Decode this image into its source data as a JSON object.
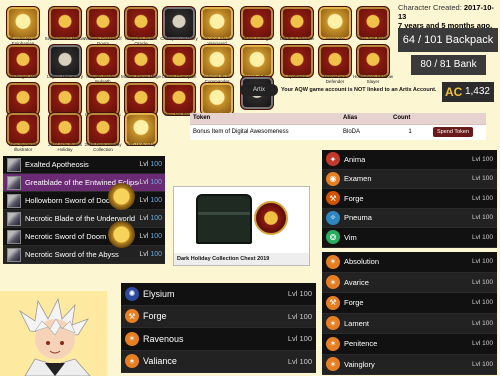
{
  "badges": [
    {
      "label": "Bloodsnapper Epiphanian",
      "style": "gold"
    },
    {
      "label": "Sepulchure's Hollow",
      "style": ""
    },
    {
      "label": "Nuclear Crazed Of Doom",
      "style": ""
    },
    {
      "label": "Nulgath's Grand Oracle",
      "style": ""
    },
    {
      "label": "Champion of Glory",
      "style": "dark"
    },
    {
      "label": "Draconic Flame Vanguard",
      "style": "gold"
    },
    {
      "label": "Chaos Avenger",
      "style": ""
    },
    {
      "label": "Blade of Shadow",
      "style": ""
    },
    {
      "label": "Awesome",
      "style": "gold"
    },
    {
      "label": "You Just Read",
      "style": ""
    },
    {
      "label": "Harbinger Hall",
      "style": ""
    },
    {
      "label": "Legion Mercenary",
      "style": "dark"
    },
    {
      "label": "Nulgath Blade of Nulgath",
      "style": ""
    },
    {
      "label": "Master Flame Mage",
      "style": ""
    },
    {
      "label": "Chaos Champion",
      "style": ""
    },
    {
      "label": "Celestial Pirate Commander",
      "style": "gold"
    },
    {
      "label": "Dragon of Time",
      "style": "gold"
    },
    {
      "label": "Apothesis",
      "style": ""
    },
    {
      "label": "Hollowborn Defender",
      "style": ""
    },
    {
      "label": "Hollowborn Shadow Slayer",
      "style": ""
    },
    {
      "label": "Hollowborn Archfiend",
      "style": ""
    },
    {
      "label": "Hollowborn Harbinger",
      "style": ""
    },
    {
      "label": "Master of Moglins",
      "style": ""
    },
    {
      "label": "Player Advisor",
      "style": ""
    },
    {
      "label": "New Nel Brent",
      "style": ""
    },
    {
      "label": "Martial Mind",
      "style": "gold"
    },
    {
      "label": "",
      "style": "dark"
    },
    {
      "label": "Artix Systems' Illustrator",
      "style": ""
    },
    {
      "label": "2024 Artix Points Holiday",
      "style": ""
    },
    {
      "label": "2019 Dark Holiday Collection",
      "style": ""
    },
    {
      "label": "10th Unholiday",
      "style": "gold"
    }
  ],
  "account": {
    "created_label": "Character Created:",
    "created_date": "2017-10-13",
    "age": "7 years and 5 months ago."
  },
  "backpack": "64 / 101 Backpack",
  "bank": "80 / 81 Bank",
  "ac": {
    "symbol": "AC",
    "value": "1,432"
  },
  "notice": {
    "logo": "Artix",
    "message": "Your AQW game account is NOT linked to an Artix Account."
  },
  "token_table": {
    "headers": [
      "Token",
      "Alias",
      "Count",
      ""
    ],
    "rows": [
      {
        "token": "Bonus Item of Digital Awesomeness",
        "alias": "BloDA",
        "count": "1",
        "action": "Spend Token"
      }
    ]
  },
  "weapons": [
    {
      "name": "Exalted Apotheosis",
      "lvl": "Lvl ",
      "num": "100",
      "highlight": false
    },
    {
      "name": "Greatblade of the Entwined Eclipse",
      "lvl": "Lvl ",
      "num": "100",
      "highlight": true
    },
    {
      "name": "Hollowborn Sword of Doom",
      "lvl": "Lvl ",
      "num": "100",
      "highlight": false
    },
    {
      "name": "Necrotic Blade of the Underworld",
      "lvl": "Lvl ",
      "num": "100",
      "highlight": false
    },
    {
      "name": "Necrotic Sword of Doom",
      "lvl": "Lvl ",
      "num": "100",
      "highlight": false
    },
    {
      "name": "Necrotic Sword of the Abyss",
      "lvl": "Lvl ",
      "num": "100",
      "highlight": false
    }
  ],
  "chest": {
    "caption": "Dark Holiday Collection Chest 2019"
  },
  "houses": [
    {
      "name": "Anima",
      "lvl": "Lvl 100",
      "color": "#c0392b",
      "icon": "anima-icon",
      "glyph": "✦"
    },
    {
      "name": "Examen",
      "lvl": "Lvl 100",
      "color": "#e67e22",
      "icon": "examen-icon",
      "glyph": "◉"
    },
    {
      "name": "Forge",
      "lvl": "Lvl 100",
      "color": "#d35400",
      "icon": "forge-icon",
      "glyph": "⚒"
    },
    {
      "name": "Pneuma",
      "lvl": "Lvl 100",
      "color": "#2e86c1",
      "icon": "pneuma-icon",
      "glyph": "✧"
    },
    {
      "name": "Vim",
      "lvl": "Lvl 100",
      "color": "#27ae60",
      "icon": "vim-icon",
      "glyph": "❂"
    }
  ],
  "lore": [
    {
      "name": "Absolution",
      "lvl": "Lvl 100",
      "color": "#e67e22",
      "icon": "absolution-icon",
      "glyph": "✶"
    },
    {
      "name": "Avarice",
      "lvl": "Lvl 100",
      "color": "#e67e22",
      "icon": "avarice-icon",
      "glyph": "✶"
    },
    {
      "name": "Forge",
      "lvl": "Lvl 100",
      "color": "#e67e22",
      "icon": "forge-icon",
      "glyph": "⚒"
    },
    {
      "name": "Lament",
      "lvl": "Lvl 100",
      "color": "#e67e22",
      "icon": "lament-icon",
      "glyph": "✶"
    },
    {
      "name": "Penitence",
      "lvl": "Lvl 100",
      "color": "#e67e22",
      "icon": "penitence-icon",
      "glyph": "✶"
    },
    {
      "name": "Vainglory",
      "lvl": "Lvl 100",
      "color": "#e67e22",
      "icon": "vainglory-icon",
      "glyph": "✶"
    }
  ],
  "classes": [
    {
      "name": "Elysium",
      "lvl": "Lvl 100",
      "color": "#2e4a9e",
      "icon": "elysium-icon",
      "glyph": "✺"
    },
    {
      "name": "Forge",
      "lvl": "Lvl 100",
      "color": "#e67e22",
      "icon": "forge-icon",
      "glyph": "⚒"
    },
    {
      "name": "Ravenous",
      "lvl": "Lvl 100",
      "color": "#e67e22",
      "icon": "ravenous-icon",
      "glyph": "✶"
    },
    {
      "name": "Valiance",
      "lvl": "Lvl 100",
      "color": "#e67e22",
      "icon": "valiance-icon",
      "glyph": "✶"
    }
  ]
}
